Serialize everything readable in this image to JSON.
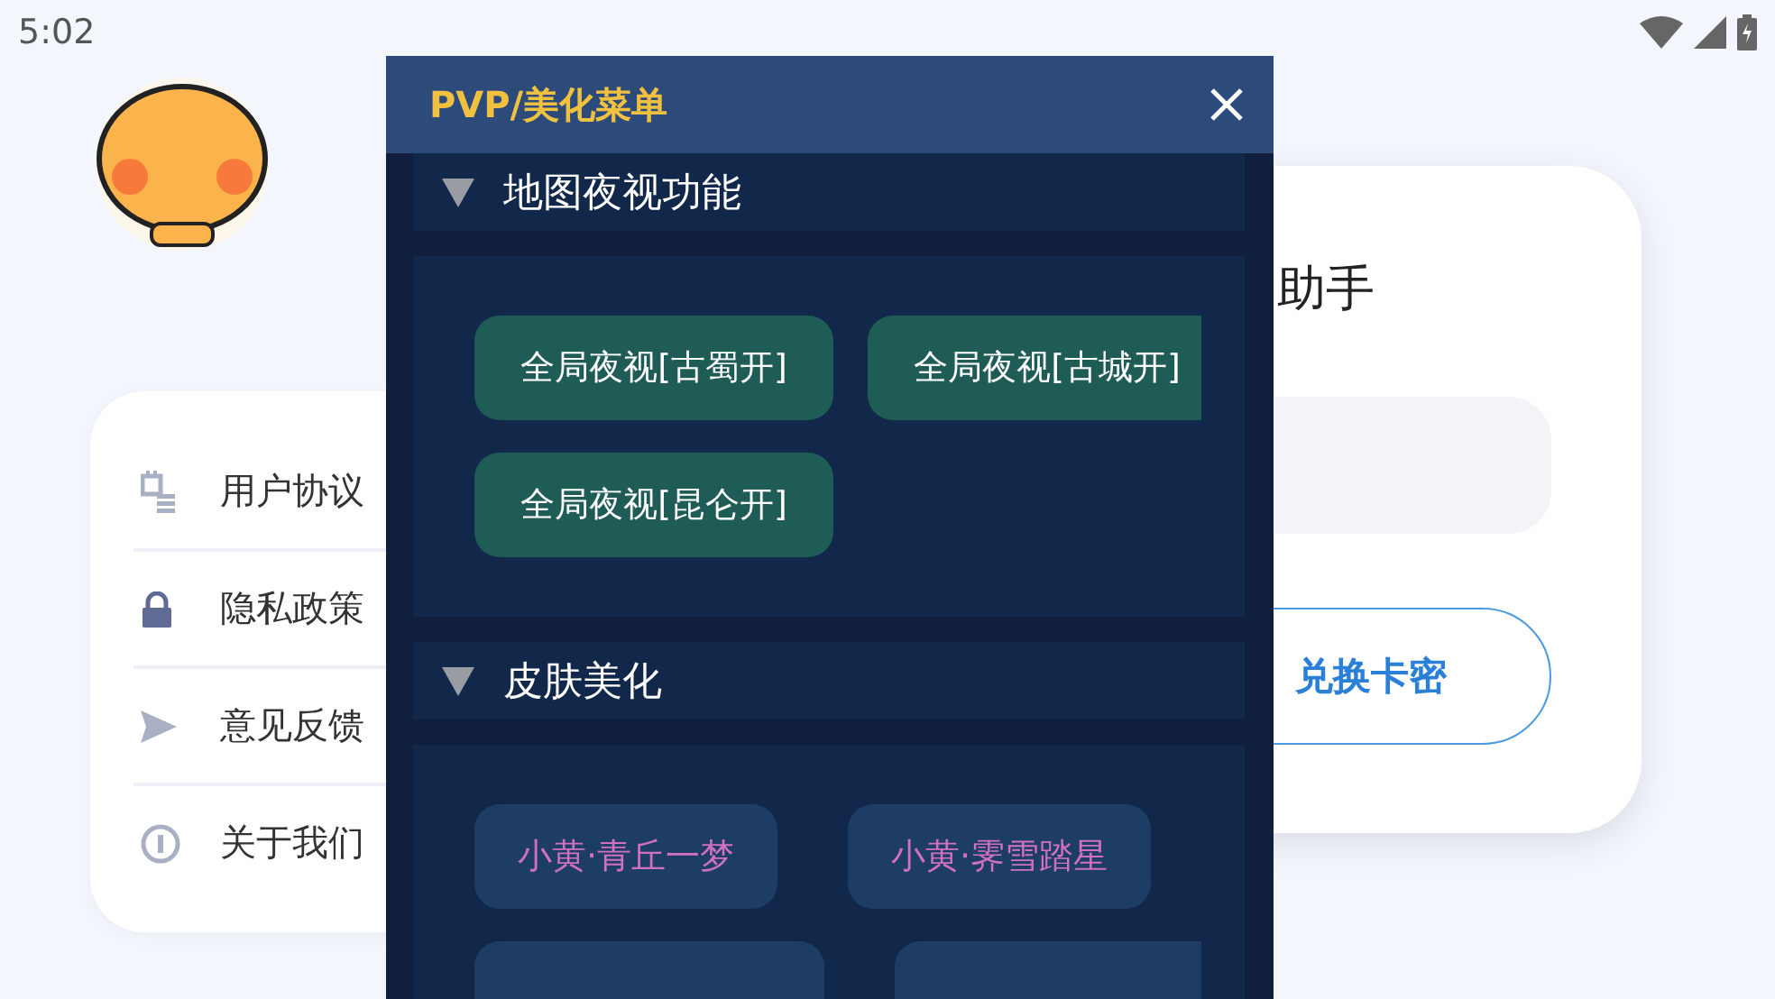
{
  "status_bar": {
    "time": "5:02"
  },
  "menu_list": [
    {
      "label": "用户协议"
    },
    {
      "label": "隐私政策"
    },
    {
      "label": "意见反馈"
    },
    {
      "label": "关于我们"
    }
  ],
  "login_card": {
    "title": "助手",
    "button": "兑换卡密"
  },
  "overlay": {
    "title": "PVP/美化菜单",
    "sections": [
      {
        "title": "地图夜视功能",
        "expanded": true,
        "buttons": [
          {
            "kind": "feature",
            "label": "全局夜视[古蜀开]"
          },
          {
            "kind": "feature",
            "label": "全局夜视[古城开]"
          },
          {
            "kind": "feature",
            "label": "全局夜视[昆仑开]"
          }
        ]
      },
      {
        "title": "皮肤美化",
        "expanded": true,
        "buttons": [
          {
            "kind": "skin",
            "label": "小黄·青丘一梦"
          },
          {
            "kind": "skin",
            "label": "小黄·霁雪踏星"
          },
          {
            "kind": "obscured"
          },
          {
            "kind": "obscured"
          }
        ]
      }
    ]
  }
}
